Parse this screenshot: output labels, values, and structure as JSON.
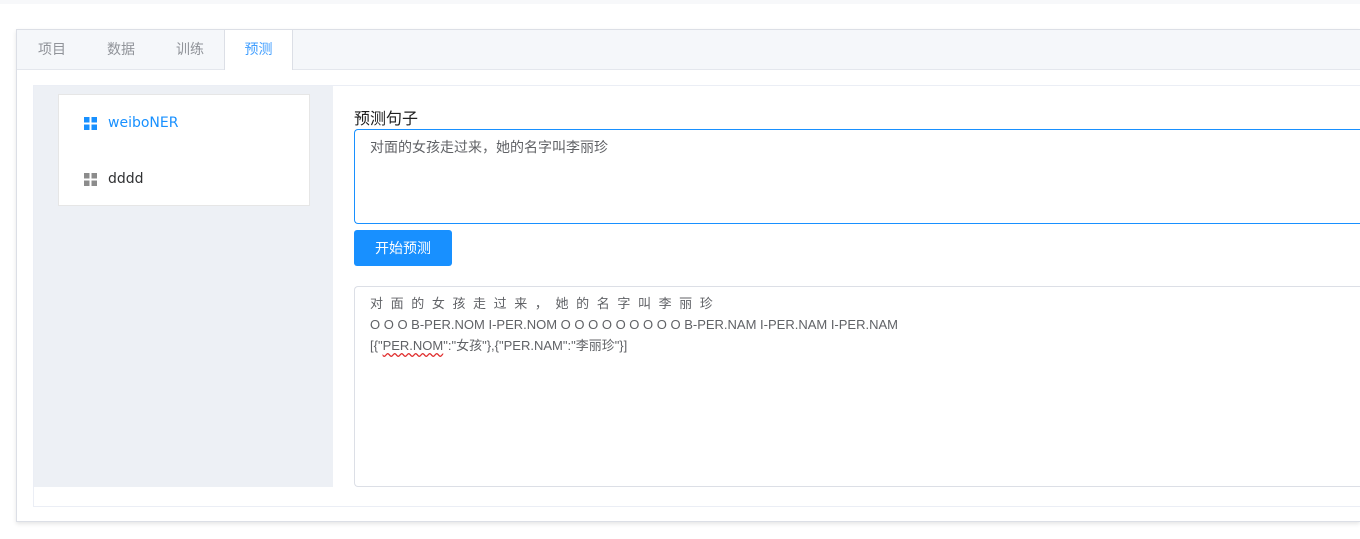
{
  "tabs": [
    {
      "label": "项目",
      "active": false
    },
    {
      "label": "数据",
      "active": false
    },
    {
      "label": "训练",
      "active": false
    },
    {
      "label": "预测",
      "active": true
    }
  ],
  "sidebar": {
    "items": [
      {
        "label": "weiboNER",
        "icon": "grid-icon",
        "active": true
      },
      {
        "label": "dddd",
        "icon": "grid-icon",
        "active": false
      }
    ]
  },
  "predict": {
    "title": "预测句子",
    "input_value": "对面的女孩走过来，她的名字叫李丽珍",
    "button_label": "开始预测"
  },
  "result": {
    "tokens": "对 面 的 女 孩 走 过 来 ， 她 的 名 字 叫 李 丽 珍",
    "tags": "O O O B-PER.NOM I-PER.NOM O O O O O O O O O B-PER.NAM I-PER.NAM I-PER.NAM",
    "entities_prefix": "[{\"",
    "entities_flagged": "PER.NOM",
    "entities_suffix": "\":\"女孩\"},{\"PER.NAM\":\"李丽珍\"}]"
  },
  "colors": {
    "accent": "#1890ff",
    "tab_active": "#409eff",
    "icon_inactive": "#8c8c8c",
    "aside_bg": "#edf0f5"
  }
}
